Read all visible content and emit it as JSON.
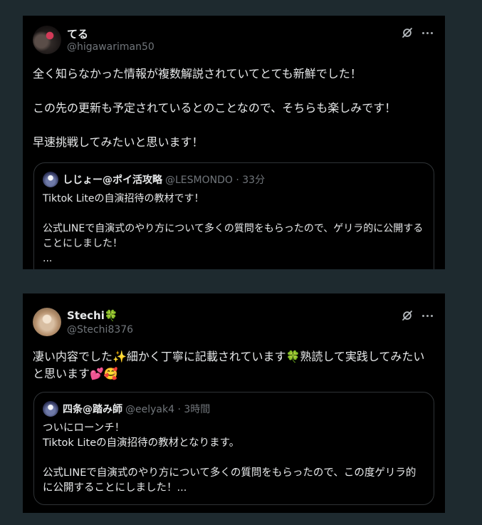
{
  "posts": [
    {
      "name": "てる",
      "handle": "@higawariman50",
      "text": "全く知らなかった情報が複数解説されていてとても新鮮でした！\n\nこの先の更新も予定されているとのことなので、そちらも楽しみです！\n\n早速挑戦してみたいと思います！",
      "quote": {
        "name": "しじょー@ポイ活攻略",
        "meta": "@LESMONDO · 33分",
        "text": "Tiktok Liteの自演招待の教材です！\n\n公式LINEで自演式のやり方について多くの質問をもらったので、ゲリラ的に公開することにしました！\n..."
      }
    },
    {
      "name": "Stechi",
      "name_emoji": "🍀",
      "handle": "@Stechi8376",
      "text": "凄い内容でした✨細かく丁寧に記載されています🍀熟読して実践してみたいと思います💕🥰",
      "quote": {
        "name": "四条@踏み師",
        "meta": "@eelyak4 · 3時間",
        "text": "ついにローンチ！\nTiktok Liteの自演招待の教材となります。\n\n公式LINEで自演式のやり方について多くの質問をもらったので、この度ゲリラ的に公開することにしました！..."
      }
    }
  ],
  "icons": {
    "grok": "grok-icon",
    "more": "more-icon"
  },
  "colors": {
    "background": "#1e2a2f",
    "card": "#000000",
    "text": "#e7e9ea",
    "muted": "#71767b",
    "border": "#2f3336"
  }
}
